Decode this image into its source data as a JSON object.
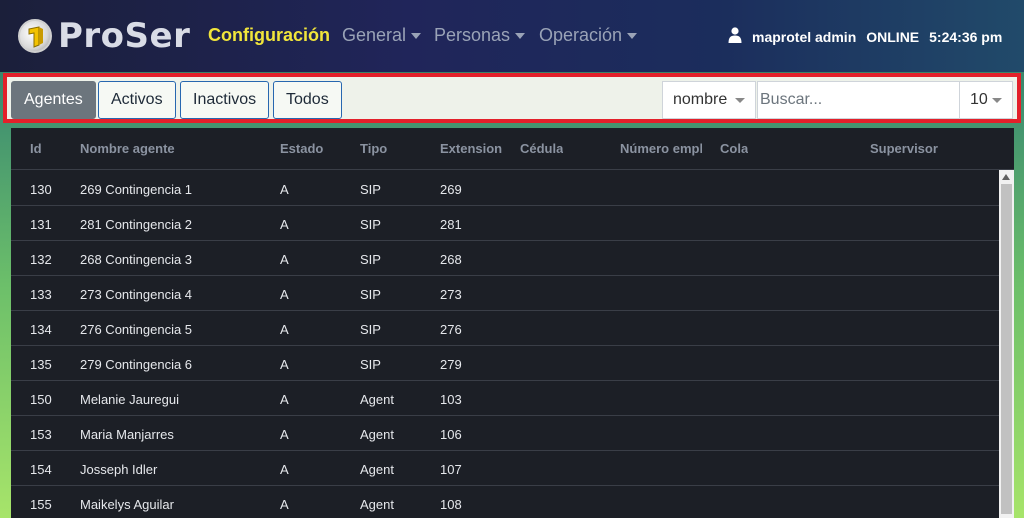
{
  "brand": {
    "name": "ProSer"
  },
  "nav": {
    "configuracion": "Configuración",
    "general": "General",
    "personas": "Personas",
    "operacion": "Operación",
    "user": "maprotel admin",
    "status": "ONLINE",
    "time": "5:24:36 pm"
  },
  "toolbar": {
    "agentes": "Agentes",
    "activos": "Activos",
    "inactivos": "Inactivos",
    "todos": "Todos",
    "filter_field": "nombre",
    "search_placeholder": "Buscar...",
    "page_size": "10"
  },
  "table": {
    "headers": {
      "id": "Id",
      "nombre": "Nombre agente",
      "estado": "Estado",
      "tipo": "Tipo",
      "extension": "Extension",
      "cedula": "Cédula",
      "numero": "Número empleado",
      "cola": "Cola",
      "supervisor": "Supervisor"
    },
    "rows": [
      {
        "id": "130",
        "nombre": "269 Contingencia 1",
        "estado": "A",
        "tipo": "SIP",
        "extension": "269"
      },
      {
        "id": "131",
        "nombre": "281 Contingencia 2",
        "estado": "A",
        "tipo": "SIP",
        "extension": "281"
      },
      {
        "id": "132",
        "nombre": "268 Contingencia 3",
        "estado": "A",
        "tipo": "SIP",
        "extension": "268"
      },
      {
        "id": "133",
        "nombre": "273 Contingencia 4",
        "estado": "A",
        "tipo": "SIP",
        "extension": "273"
      },
      {
        "id": "134",
        "nombre": "276 Contingencia 5",
        "estado": "A",
        "tipo": "SIP",
        "extension": "276"
      },
      {
        "id": "135",
        "nombre": "279 Contingencia 6",
        "estado": "A",
        "tipo": "SIP",
        "extension": "279"
      },
      {
        "id": "150",
        "nombre": "Melanie Jauregui",
        "estado": "A",
        "tipo": "Agent",
        "extension": "103"
      },
      {
        "id": "153",
        "nombre": "Maria Manjarres",
        "estado": "A",
        "tipo": "Agent",
        "extension": "106"
      },
      {
        "id": "154",
        "nombre": "Josseph Idler",
        "estado": "A",
        "tipo": "Agent",
        "extension": "107"
      },
      {
        "id": "155",
        "nombre": "Maikelys Aguilar",
        "estado": "A",
        "tipo": "Agent",
        "extension": "108"
      }
    ]
  },
  "icons": {
    "user": "user-icon",
    "logo": "proser-logo-icon"
  },
  "colors": {
    "active_nav": "#f1e53b",
    "highlight": "#e3202a",
    "selected_button": "#6c757d"
  }
}
